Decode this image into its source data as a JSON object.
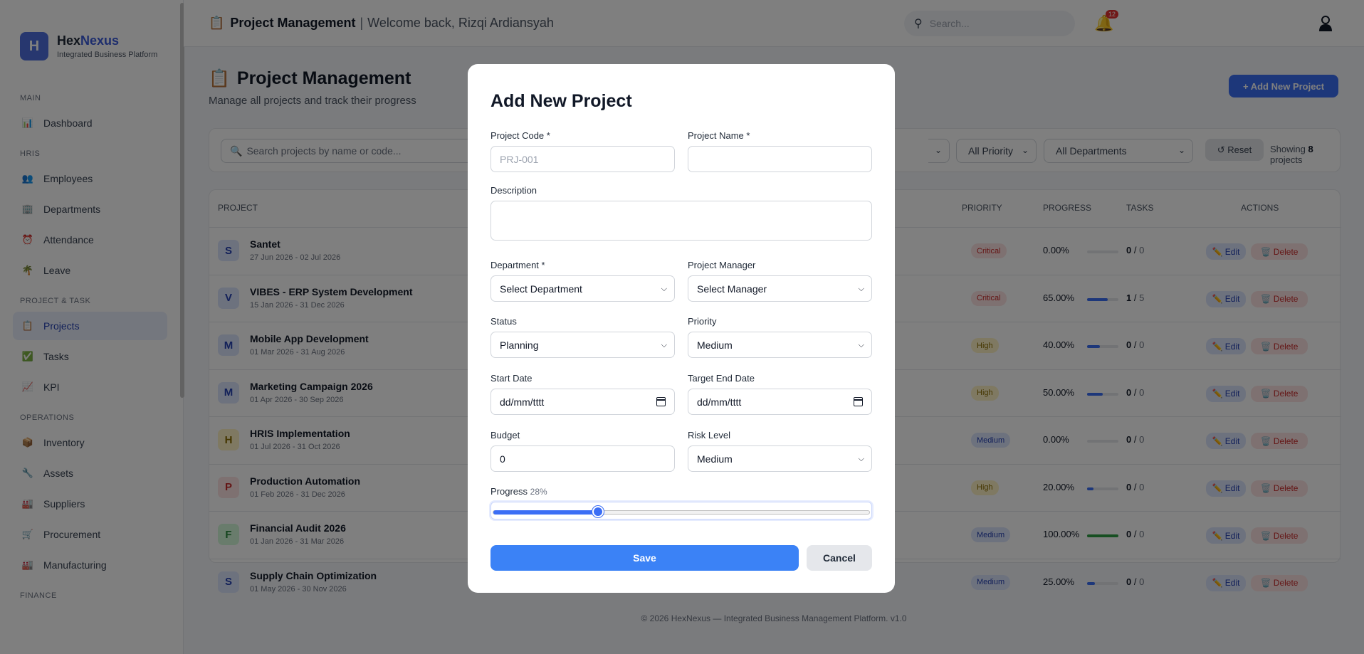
{
  "brand": {
    "name_part1": "Hex",
    "name_part2": "Nexus",
    "logo_letter": "H",
    "subtitle": "Integrated Business Platform"
  },
  "sidebar": {
    "sections": [
      {
        "label": "MAIN",
        "items": [
          {
            "label": "Dashboard",
            "icon": "dashboard-icon"
          }
        ]
      },
      {
        "label": "HRIS",
        "items": [
          {
            "label": "Employees",
            "icon": "employees-icon"
          },
          {
            "label": "Departments",
            "icon": "departments-icon"
          },
          {
            "label": "Attendance",
            "icon": "alarm-clock-icon"
          },
          {
            "label": "Leave",
            "icon": "leave-icon"
          }
        ]
      },
      {
        "label": "PROJECT & TASK",
        "items": [
          {
            "label": "Projects",
            "icon": "clipboard-icon",
            "active": true
          },
          {
            "label": "Tasks",
            "icon": "checkbox-icon"
          },
          {
            "label": "KPI",
            "icon": "chart-icon"
          }
        ]
      },
      {
        "label": "OPERATIONS",
        "items": [
          {
            "label": "Inventory",
            "icon": "box-icon"
          },
          {
            "label": "Assets",
            "icon": "wrench-icon"
          },
          {
            "label": "Suppliers",
            "icon": "factory-icon"
          },
          {
            "label": "Procurement",
            "icon": "cart-icon"
          },
          {
            "label": "Manufacturing",
            "icon": "factory-icon"
          }
        ]
      },
      {
        "label": "FINANCE",
        "items": []
      }
    ]
  },
  "topbar": {
    "title": "Project Management",
    "separator": "|",
    "welcome": "Welcome back, Rizqi Ardiansyah",
    "search_placeholder": "Search...",
    "notification_count": "12"
  },
  "page": {
    "title": "Project Management",
    "subtitle": "Manage all projects and track their progress",
    "add_button": "+ Add New Project"
  },
  "filters": {
    "search_placeholder": "Search projects by name or code...",
    "priority": "All Priority",
    "department": "All Departments",
    "reset": "↺ Reset",
    "showing_prefix": "Showing",
    "showing_count": "8",
    "showing_suffix": "projects"
  },
  "table": {
    "headers": {
      "project": "PROJECT",
      "priority": "PRIORITY",
      "progress": "PROGRESS",
      "tasks": "TASKS",
      "actions": "ACTIONS"
    },
    "edit_label": "Edit",
    "delete_label": "Delete",
    "rows": [
      {
        "initial": "S",
        "name": "Santet",
        "dates": "27 Jun 2026 - 02 Jul 2026",
        "priority": "Critical",
        "progress": "0.00%",
        "progress_value": 0,
        "tasks_done": "0",
        "tasks_total": "0"
      },
      {
        "initial": "V",
        "name": "VIBES - ERP System Development",
        "dates": "15 Jan 2026 - 31 Dec 2026",
        "priority": "Critical",
        "progress": "65.00%",
        "progress_value": 65,
        "tasks_done": "1",
        "tasks_total": "5"
      },
      {
        "initial": "M",
        "name": "Mobile App Development",
        "dates": "01 Mar 2026 - 31 Aug 2026",
        "priority": "High",
        "progress": "40.00%",
        "progress_value": 40,
        "tasks_done": "0",
        "tasks_total": "0"
      },
      {
        "initial": "M",
        "name": "Marketing Campaign 2026",
        "dates": "01 Apr 2026 - 30 Sep 2026",
        "priority": "High",
        "progress": "50.00%",
        "progress_value": 50,
        "tasks_done": "0",
        "tasks_total": "0"
      },
      {
        "initial": "H",
        "name": "HRIS Implementation",
        "dates": "01 Jul 2026 - 31 Oct 2026",
        "priority": "Medium",
        "progress": "0.00%",
        "progress_value": 0,
        "tasks_done": "0",
        "tasks_total": "0"
      },
      {
        "initial": "P",
        "name": "Production Automation",
        "dates": "01 Feb 2026 - 31 Dec 2026",
        "priority": "High",
        "progress": "20.00%",
        "progress_value": 20,
        "tasks_done": "0",
        "tasks_total": "0"
      },
      {
        "initial": "F",
        "name": "Financial Audit 2026",
        "dates": "01 Jan 2026 - 31 Mar 2026",
        "priority": "Medium",
        "progress": "100.00%",
        "progress_value": 100,
        "tasks_done": "0",
        "tasks_total": "0"
      },
      {
        "initial": "S",
        "name": "Supply Chain Optimization",
        "dates": "01 May 2026 - 30 Nov 2026",
        "priority": "Medium",
        "progress": "25.00%",
        "progress_value": 25,
        "tasks_done": "0",
        "tasks_total": "0"
      }
    ]
  },
  "footer": "© 2026 HexNexus — Integrated Business Management Platform. v1.0",
  "modal": {
    "title": "Add New Project",
    "project_code_label": "Project Code *",
    "project_code_placeholder": "PRJ-001",
    "project_name_label": "Project Name *",
    "project_name_value": "",
    "description_label": "Description",
    "department_label": "Department *",
    "department_value": "Select Department",
    "manager_label": "Project Manager",
    "manager_value": "Select Manager",
    "status_label": "Status",
    "status_value": "Planning",
    "priority_label": "Priority",
    "priority_value": "Medium",
    "start_date_label": "Start Date",
    "start_date_value": "dd/mm/tttt",
    "end_date_label": "Target End Date",
    "end_date_value": "dd/mm/tttt",
    "budget_label": "Budget",
    "budget_value": "0",
    "risk_label": "Risk Level",
    "risk_value": "Medium",
    "progress_label": "Progress",
    "progress_pct": "28%",
    "progress_value": 28,
    "save": "Save",
    "cancel": "Cancel"
  },
  "colors": {
    "accent": "#3b6ef5",
    "critical_bg": "#fde2e2",
    "critical_fg": "#c92a2a",
    "high_bg": "#fff3c4",
    "high_fg": "#8a6d00",
    "medium_bg": "#dbe4fd",
    "medium_fg": "#2541b2",
    "complete": "#2f9e44"
  }
}
